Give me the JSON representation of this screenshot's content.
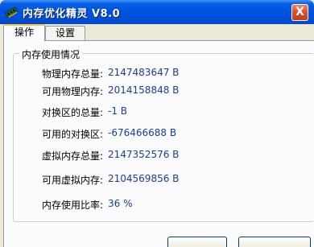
{
  "window": {
    "title": "内存优化精灵  V8.0",
    "close_label": "X",
    "icon": "memory-chip-icon"
  },
  "tabs": [
    {
      "label": "操作",
      "active": true
    },
    {
      "label": "设置",
      "active": false
    }
  ],
  "memory": {
    "group_title": "内存使用情况",
    "rows": [
      {
        "label": "物理内存总量:",
        "value": "2147483647 B"
      },
      {
        "label": "可用物理内存:",
        "value": "2014158848 B"
      },
      {
        "label": "对换区的总量:",
        "value": "-1 B"
      },
      {
        "label": "可用的对换区:",
        "value": "-676466688 B"
      },
      {
        "label": "虚拟内存总量:",
        "value": "2147352576 B"
      },
      {
        "label": "可用虚拟内存:",
        "value": "2104569856 B"
      },
      {
        "label": "内存使用比率:",
        "value": "36 %"
      }
    ]
  },
  "colors": {
    "titlebar": "#0054e3",
    "value_text": "#1a3aa0",
    "active_tab_accent": "#ffc83c"
  }
}
